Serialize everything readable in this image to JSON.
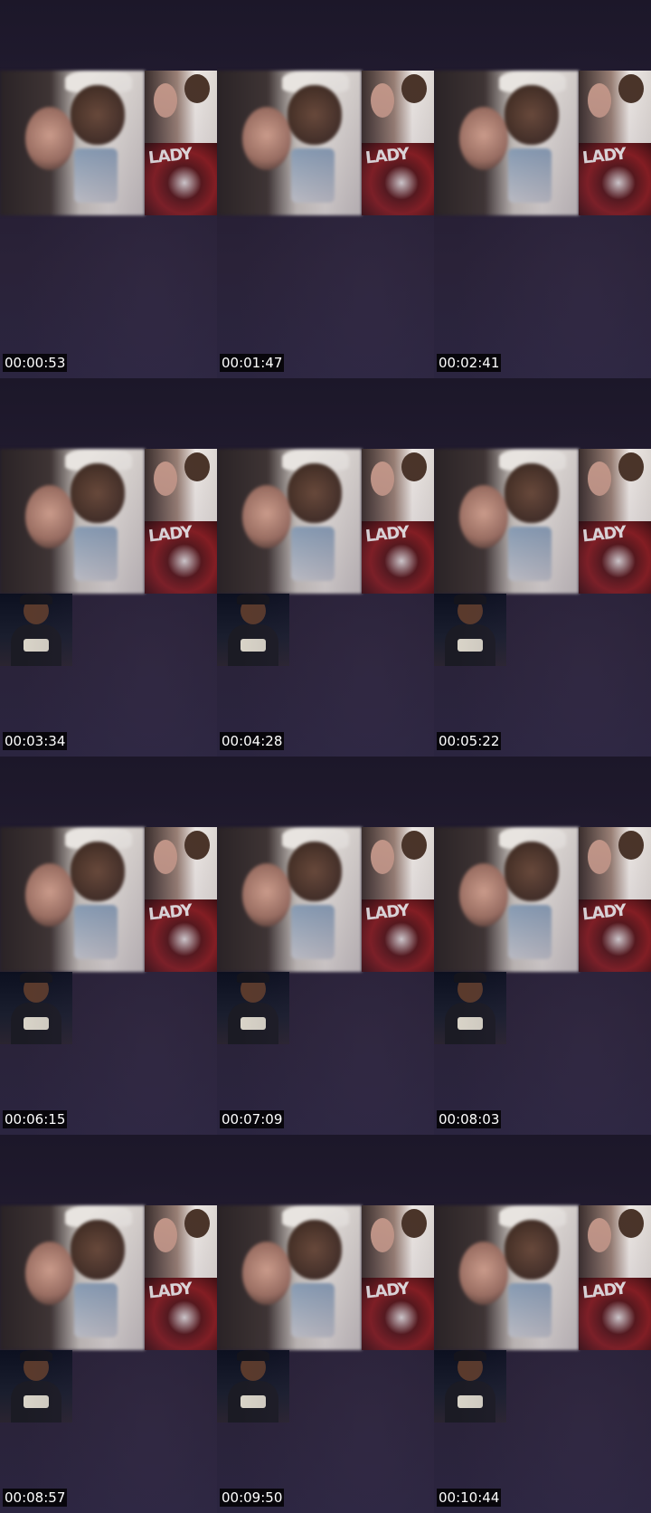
{
  "thumbnails": [
    {
      "timestamp": "00:00:53",
      "has_lower_thumb": false
    },
    {
      "timestamp": "00:01:47",
      "has_lower_thumb": false
    },
    {
      "timestamp": "00:02:41",
      "has_lower_thumb": false
    },
    {
      "timestamp": "00:03:34",
      "has_lower_thumb": true
    },
    {
      "timestamp": "00:04:28",
      "has_lower_thumb": true
    },
    {
      "timestamp": "00:05:22",
      "has_lower_thumb": true
    },
    {
      "timestamp": "00:06:15",
      "has_lower_thumb": true
    },
    {
      "timestamp": "00:07:09",
      "has_lower_thumb": true
    },
    {
      "timestamp": "00:08:03",
      "has_lower_thumb": true
    },
    {
      "timestamp": "00:08:57",
      "has_lower_thumb": true
    },
    {
      "timestamp": "00:09:50",
      "has_lower_thumb": true
    },
    {
      "timestamp": "00:10:44",
      "has_lower_thumb": true
    }
  ],
  "poster_text": "LADY",
  "colors": {
    "background": "#1f1a2c",
    "timestamp_bg": "#000000",
    "timestamp_text": "#ffffff"
  }
}
